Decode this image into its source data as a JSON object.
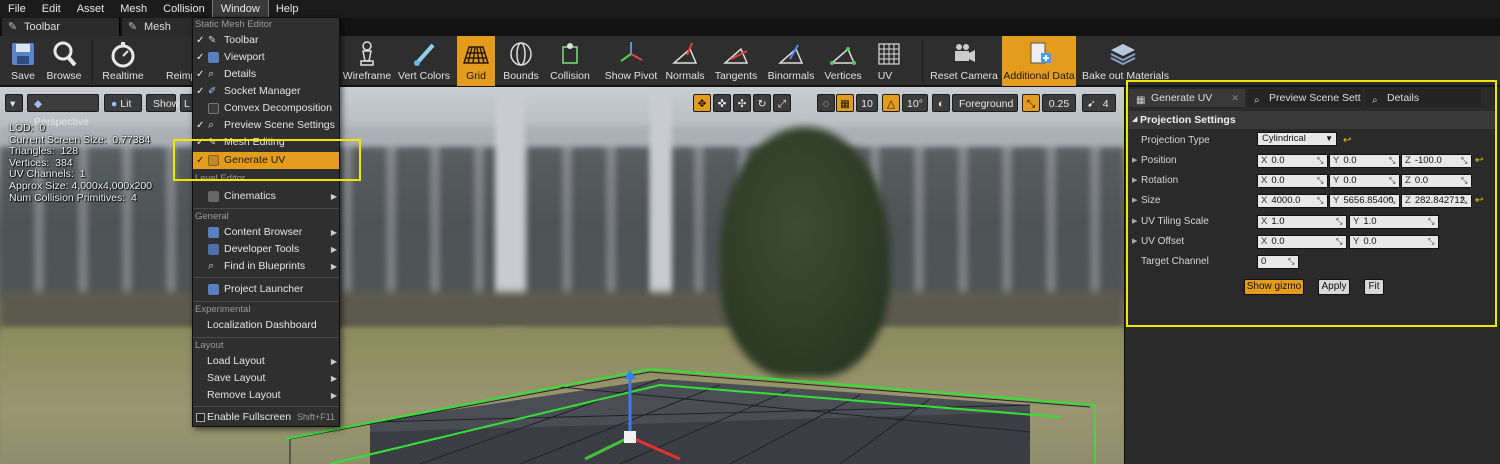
{
  "menubar": [
    "File",
    "Edit",
    "Asset",
    "Mesh",
    "Collision",
    "Window",
    "Help"
  ],
  "tabs": [
    {
      "label": "Toolbar"
    },
    {
      "label": "Mesh Editing"
    }
  ],
  "toolbar": {
    "save": "Save",
    "browse": "Browse",
    "realtime": "Realtime",
    "reimport": "Reimport",
    "wireframe": "Wireframe",
    "vert_colors": "Vert Colors",
    "grid": "Grid",
    "bounds": "Bounds",
    "collision": "Collision",
    "show_pivot": "Show Pivot",
    "normals": "Normals",
    "tangents": "Tangents",
    "binormals": "Binormals",
    "vertices": "Vertices",
    "uv": "UV",
    "reset_camera": "Reset Camera",
    "additional_data": "Additional Data",
    "bake_out": "Bake out Materials"
  },
  "viewport": {
    "perspective": "Perspective",
    "lit": "Lit",
    "show": "Show",
    "layer": "Foreground",
    "grid_snap": "10",
    "rot_snap": "10°",
    "scale_snap": "0.25",
    "cam_speed": "4",
    "stats": [
      "LOD:  0",
      "Current Screen Size:  0.77384",
      "Triangles:  128",
      "Vertices:  384",
      "UV Channels:  1",
      "Approx Size: 4,000x4,000x200",
      "Num Collision Primitives:  4"
    ]
  },
  "window_menu": {
    "sections": {
      "static_mesh_editor": "Static Mesh Editor",
      "level_editor": "Level Editor",
      "general": "General",
      "experimental": "Experimental",
      "layout": "Layout"
    },
    "items": {
      "toolbar": "Toolbar",
      "viewport": "Viewport",
      "details": "Details",
      "socket_manager": "Socket Manager",
      "convex": "Convex Decomposition",
      "preview_scene": "Preview Scene Settings",
      "mesh_editing": "Mesh Editing",
      "generate_uv": "Generate UV",
      "cinematics": "Cinematics",
      "content_browser": "Content Browser",
      "developer_tools": "Developer Tools",
      "find_in_blueprints": "Find in Blueprints",
      "project_launcher": "Project Launcher",
      "localization": "Localization Dashboard",
      "load_layout": "Load Layout",
      "save_layout": "Save Layout",
      "remove_layout": "Remove Layout",
      "fullscreen": "Enable Fullscreen",
      "fullscreen_shortcut": "Shift+F11"
    }
  },
  "panel": {
    "tabs": [
      "Generate UV",
      "Preview Scene Sett",
      "Details"
    ],
    "section": "Projection Settings",
    "projection_type_label": "Projection Type",
    "projection_type": "Cylindrical",
    "position_label": "Position",
    "position": {
      "x": "0.0",
      "y": "0.0",
      "z": "-100.0"
    },
    "rotation_label": "Rotation",
    "rotation": {
      "x": "0.0",
      "y": "0.0",
      "z": "0.0"
    },
    "size_label": "Size",
    "size": {
      "x": "4000.0",
      "y": "5656.85400",
      "z": "282.842712"
    },
    "uv_tiling_label": "UV Tiling Scale",
    "uv_tiling": {
      "x": "1.0",
      "y": "1.0"
    },
    "uv_offset_label": "UV Offset",
    "uv_offset": {
      "x": "0.0",
      "y": "0.0"
    },
    "target_channel_label": "Target Channel",
    "target_channel": "0",
    "show_gizmo": "Show gizmo",
    "apply": "Apply",
    "fit": "Fit"
  },
  "colors": {
    "accent": "#e49c1d",
    "annotation": "#f2e600"
  }
}
